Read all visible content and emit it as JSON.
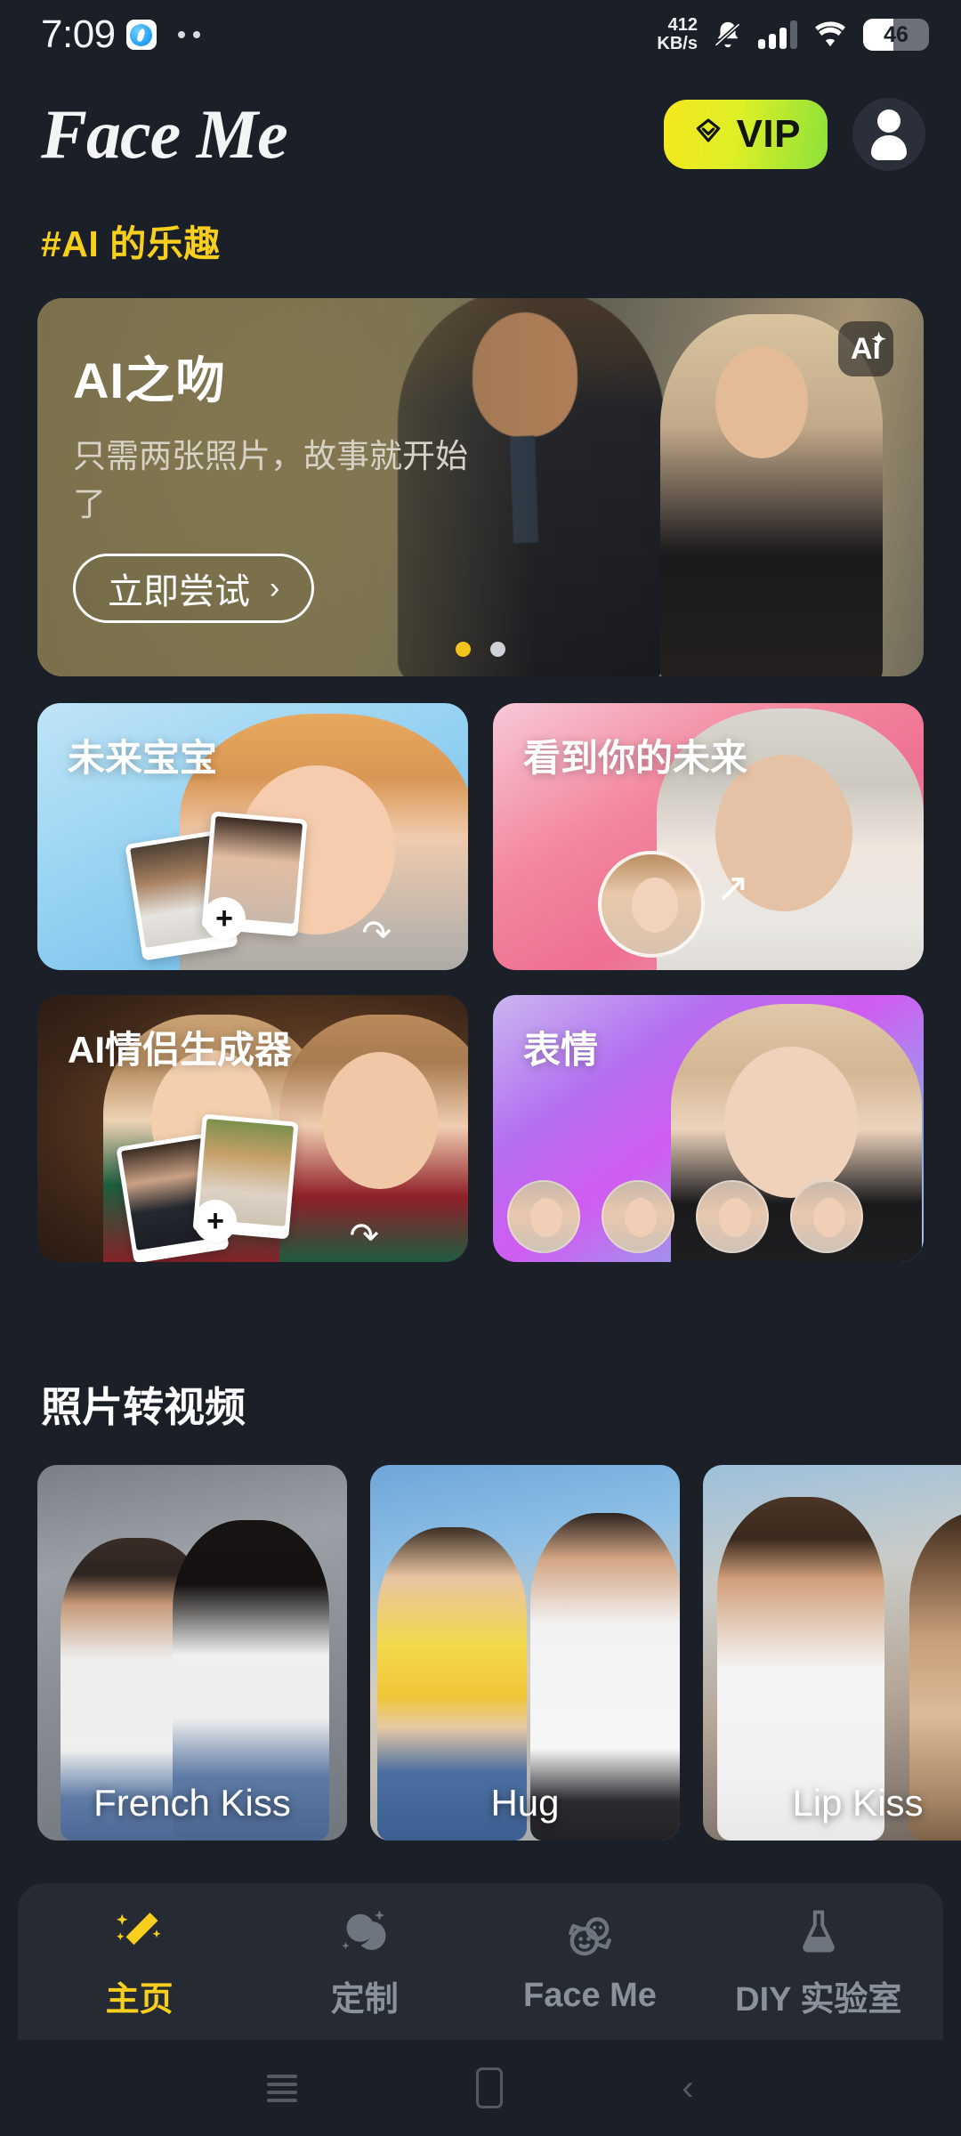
{
  "statusbar": {
    "time": "7:09",
    "app_icon": "compass-icon",
    "network_speed": "412",
    "network_speed_unit": "KB/s",
    "notification_icon": "bell-muted-icon",
    "signal_icon": "cellular-signal-icon",
    "wifi_icon": "wifi-icon",
    "battery_level": "46"
  },
  "header": {
    "brand": "Face Me",
    "vip_label": "VIP",
    "vip_icon": "diamond-icon",
    "avatar_icon": "user-avatar-icon",
    "vip_gradient_start": "#F6E71F",
    "vip_gradient_end": "#8CE13A"
  },
  "sections": {
    "fun_title": "#AI 的乐趣",
    "fun_title_color": "#F8CF1C",
    "video_title": "照片转视频"
  },
  "hero": {
    "title": "AI之吻",
    "subtitle": "只需两张照片，故事就开始了",
    "cta_label": "立即尝试",
    "cta_chevron": "›",
    "ai_badge": "Ai",
    "ai_badge_sparkle": "✦",
    "dots": [
      {
        "active": true,
        "color": "#F5C41A"
      },
      {
        "active": false,
        "color": "#CFD3D8"
      }
    ]
  },
  "feature_cards": [
    {
      "label": "未来宝宝",
      "plus_icon": "plus-icon",
      "arrow_icon": "swirl-arrow-icon"
    },
    {
      "label": "看到你的未来",
      "arrow_icon": "up-arrow-icon"
    },
    {
      "label": "AI情侣生成器",
      "plus_icon": "plus-icon",
      "arrow_icon": "swirl-arrow-icon"
    },
    {
      "label": "表情"
    }
  ],
  "video_cards": [
    {
      "label": "French Kiss"
    },
    {
      "label": "Hug"
    },
    {
      "label": "Lip Kiss"
    }
  ],
  "tabbar": [
    {
      "label": "主页",
      "icon": "magic-wand-icon",
      "active": true
    },
    {
      "label": "定制",
      "icon": "face-sparkle-icon",
      "active": false
    },
    {
      "label": "Face Me",
      "icon": "two-faces-icon",
      "active": false
    },
    {
      "label": "DIY 实验室",
      "icon": "flask-icon",
      "active": false
    }
  ],
  "android_nav": {
    "recents": "recents-icon",
    "home": "home-icon",
    "back": "back-icon"
  }
}
